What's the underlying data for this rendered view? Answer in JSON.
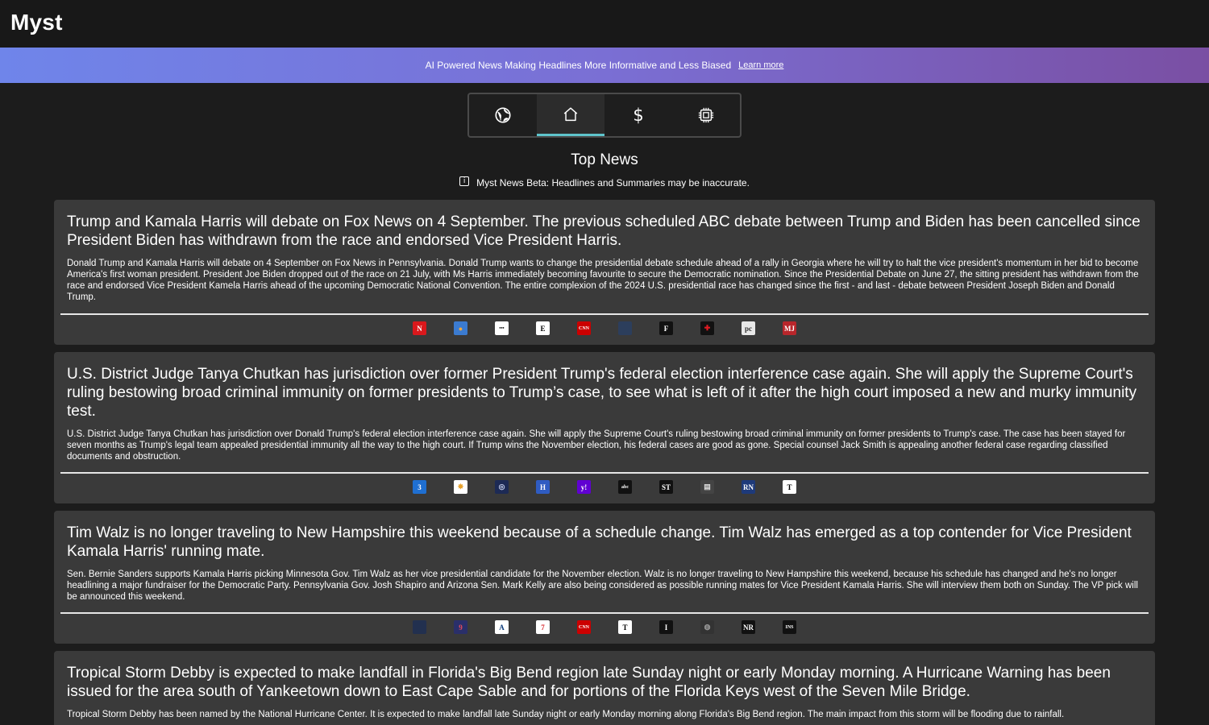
{
  "app": {
    "title": "Myst"
  },
  "banner": {
    "text": "AI Powered News Making Headlines More Informative and Less Biased",
    "link": "Learn more"
  },
  "categories": [
    {
      "icon": "globe-icon",
      "active": false
    },
    {
      "icon": "home-icon",
      "active": true
    },
    {
      "icon": "dollar-icon",
      "label": "$",
      "active": false
    },
    {
      "icon": "chip-icon",
      "active": false
    }
  ],
  "page": {
    "title": "Top News",
    "disclaimer": "Myst News Beta: Headlines and Summaries may be inaccurate."
  },
  "colors": {
    "banner_start": "#6f85ea",
    "banner_end": "#7a4fa3",
    "active_tab": "#5fc4cb",
    "card": "#3a3a3a",
    "background": "#1c1c1c"
  },
  "articles": [
    {
      "headline": "Trump and Kamala Harris will debate on Fox News on 4 September. The previous scheduled ABC debate between Trump and Biden has been cancelled since President Biden has withdrawn from the race and endorsed Vice President Harris.",
      "summary": "Donald Trump and Kamala Harris will debate on 4 September on Fox News in Pennsylvania. Donald Trump wants to change the presidential debate schedule ahead of a rally in Georgia where he will try to halt the vice president's momentum in her bid to become America's first woman president. President Joe Biden dropped out of the race on 21 July, with Ms Harris immediately becoming favourite to secure the Democratic nomination. Since the Presidential Debate on June 27, the sitting president has withdrawn from the race and endorsed Vice President Kamela Harris ahead of the upcoming Democratic National Convention. The entire complexion of the 2024 U.S. presidential race has changed since the first - and last - debate between President Joseph Biden and Donald Trump.",
      "sources": [
        {
          "icon": "source-n-icon",
          "text": "N",
          "bg": "#d9181c",
          "fg": "#ffffff"
        },
        {
          "icon": "source-circle-icon",
          "text": "●",
          "bg": "#3b7bd0",
          "fg": "#f2a93b"
        },
        {
          "icon": "source-dots-icon",
          "text": "•••",
          "bg": "#ffffff",
          "fg": "#000000"
        },
        {
          "icon": "source-economist-icon",
          "text": "E",
          "bg": "#ffffff",
          "fg": "#000000"
        },
        {
          "icon": "source-cnn-icon",
          "text": "CNN",
          "bg": "#cc0000",
          "fg": "#ffffff"
        },
        {
          "icon": "source-dark-blue-icon",
          "text": "",
          "bg": "#2c3e5c",
          "fg": "#ffffff"
        },
        {
          "icon": "source-f-icon",
          "text": "F",
          "bg": "#111111",
          "fg": "#ffffff"
        },
        {
          "icon": "source-red-cross-icon",
          "text": "✚",
          "bg": "#111111",
          "fg": "#e11b22"
        },
        {
          "icon": "source-pc-icon",
          "text": "pc",
          "bg": "#e8e8e8",
          "fg": "#333333"
        },
        {
          "icon": "source-red-square-icon",
          "text": "MJ",
          "bg": "#b8262b",
          "fg": "#ffffff"
        }
      ]
    },
    {
      "headline": "U.S. District Judge Tanya Chutkan has jurisdiction over former President Trump's federal election interference case again. She will apply the Supreme Court's ruling bestowing broad criminal immunity on former presidents to Trump’s case, to see what is left of it after the high court imposed a new and murky immunity test.",
      "summary": "U.S. District Judge Tanya Chutkan has jurisdiction over Donald Trump's federal election interference case again. She will apply the Supreme Court's ruling bestowing broad criminal immunity on former presidents to Trump's case. The case has been stayed for seven months as Trump's legal team appealed presidential immunity all the way to the high court. If Trump wins the November election, his federal cases are good as gone. Special counsel Jack Smith is appealing another federal case regarding classified documents and obstruction.",
      "sources": [
        {
          "icon": "source-3-icon",
          "text": "3",
          "bg": "#1f6fd1",
          "fg": "#ffffff"
        },
        {
          "icon": "source-nbc-icon",
          "text": "✸",
          "bg": "#ffffff",
          "fg": "#e6a12b"
        },
        {
          "icon": "source-seal-icon",
          "text": "◎",
          "bg": "#1d2a55",
          "fg": "#c9d2ef"
        },
        {
          "icon": "source-h-icon",
          "text": "H",
          "bg": "#2f5cc2",
          "fg": "#ffffff"
        },
        {
          "icon": "source-yahoo-icon",
          "text": "y!",
          "bg": "#6001d2",
          "fg": "#ffffff"
        },
        {
          "icon": "source-abc-icon",
          "text": "abc",
          "bg": "#111111",
          "fg": "#ffffff"
        },
        {
          "icon": "source-st-icon",
          "text": "ST",
          "bg": "#111111",
          "fg": "#ffffff"
        },
        {
          "icon": "source-page-icon",
          "text": "▤",
          "bg": "#444444",
          "fg": "#dddddd"
        },
        {
          "icon": "source-realnews-icon",
          "text": "RN",
          "bg": "#1e3a7a",
          "fg": "#ffffff"
        },
        {
          "icon": "source-telegraph-icon",
          "text": "T",
          "bg": "#ffffff",
          "fg": "#000000"
        }
      ]
    },
    {
      "headline": "Tim Walz is no longer traveling to New Hampshire this weekend because of a schedule change. Tim Walz has emerged as a top contender for Vice President Kamala Harris' running mate.",
      "summary": "Sen. Bernie Sanders supports Kamala Harris picking Minnesota Gov. Tim Walz as her vice presidential candidate for the November election. Walz is no longer traveling to New Hampshire this weekend, because his schedule has changed and he's no longer headlining a major fundraiser for the Democratic Party. Pennsylvania Gov. Josh Shapiro and Arizona Sen. Mark Kelly are also being considered as possible running mates for Vice President Kamala Harris. She will interview them both on Sunday. The VP pick will be announced this weekend.",
      "sources": [
        {
          "icon": "source-navy-icon",
          "text": "",
          "bg": "#22304f",
          "fg": "#ffffff"
        },
        {
          "icon": "source-9-icon",
          "text": "9",
          "bg": "#2a2f6a",
          "fg": "#e34b5c"
        },
        {
          "icon": "source-a-icon",
          "text": "A",
          "bg": "#ffffff",
          "fg": "#0a3a7a"
        },
        {
          "icon": "source-7-icon",
          "text": "7",
          "bg": "#ffffff",
          "fg": "#d7262b"
        },
        {
          "icon": "source-cnn-icon",
          "text": "CNN",
          "bg": "#cc0000",
          "fg": "#ffffff"
        },
        {
          "icon": "source-nyt-icon",
          "text": "T",
          "bg": "#ffffff",
          "fg": "#000000"
        },
        {
          "icon": "source-i-icon",
          "text": "I",
          "bg": "#111111",
          "fg": "#ffffff"
        },
        {
          "icon": "source-globe-gray-icon",
          "text": "◍",
          "bg": "#333333",
          "fg": "#999999"
        },
        {
          "icon": "source-nr-icon",
          "text": "NR",
          "bg": "#111111",
          "fg": "#ffffff"
        },
        {
          "icon": "source-ins-icon",
          "text": "INS",
          "bg": "#111111",
          "fg": "#ffffff"
        }
      ]
    },
    {
      "headline": "Tropical Storm Debby is expected to make landfall in Florida's Big Bend region late Sunday night or early Monday morning. A Hurricane Warning has been issued for the area south of Yankeetown down to East Cape Sable and for portions of the Florida Keys west of the Seven Mile Bridge.",
      "summary": "Tropical Storm Debby has been named by the National Hurricane Center. It is expected to make landfall late Sunday night or early Monday morning along Florida's Big Bend region. The main impact from this storm will be flooding due to rainfall.",
      "sources": []
    }
  ]
}
